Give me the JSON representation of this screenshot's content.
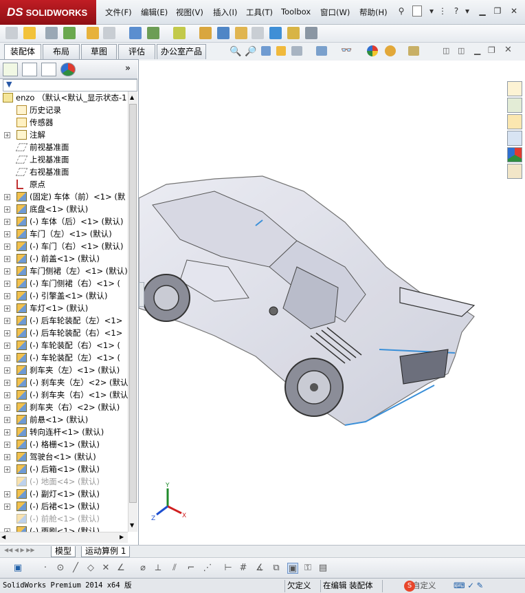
{
  "app": {
    "logo_text": "SOLIDWORKS",
    "logo_ds": "DS"
  },
  "menu": [
    "文件(F)",
    "编辑(E)",
    "视图(V)",
    "插入(I)",
    "工具(T)",
    "Toolbox",
    "窗口(W)",
    "帮助(H)"
  ],
  "command_tabs": [
    "装配体",
    "布局",
    "草图",
    "评估",
    "办公室产品"
  ],
  "tree": {
    "root": "enzo （默认<默认_显示状态-1",
    "items": [
      {
        "label": "历史记录",
        "icon": "history-icon",
        "expand": false,
        "dim": false
      },
      {
        "label": "传感器",
        "icon": "sensor-icon",
        "expand": false,
        "dim": false
      },
      {
        "label": "注解",
        "icon": "annotation-icon",
        "expand": true,
        "dim": false
      },
      {
        "label": "前视基准面",
        "icon": "plane-icon",
        "expand": false,
        "dim": false
      },
      {
        "label": "上视基准面",
        "icon": "plane-icon",
        "expand": false,
        "dim": false
      },
      {
        "label": "右视基准面",
        "icon": "plane-icon",
        "expand": false,
        "dim": false
      },
      {
        "label": "原点",
        "icon": "origin-icon",
        "expand": false,
        "dim": false
      },
      {
        "label": "(固定) 车体（前）<1> (默",
        "icon": "part-icon",
        "expand": true,
        "dim": false
      },
      {
        "label": "底盘<1> (默认)",
        "icon": "part-icon",
        "expand": true,
        "dim": false
      },
      {
        "label": "(-) 车体（后）<1> (默认)",
        "icon": "part-icon",
        "expand": true,
        "dim": false
      },
      {
        "label": "车门（左）<1> (默认)",
        "icon": "part-icon",
        "expand": true,
        "dim": false
      },
      {
        "label": "(-) 车门（右）<1> (默认)",
        "icon": "part-icon",
        "expand": true,
        "dim": false
      },
      {
        "label": "(-) 前盖<1> (默认)",
        "icon": "part-icon",
        "expand": true,
        "dim": false
      },
      {
        "label": "车门侧裙（左）<1> (默认)",
        "icon": "part-icon",
        "expand": true,
        "dim": false
      },
      {
        "label": "(-) 车门侧裙（右）<1> (",
        "icon": "part-icon",
        "expand": true,
        "dim": false
      },
      {
        "label": "(-) 引擎盖<1> (默认)",
        "icon": "part-icon",
        "expand": true,
        "dim": false
      },
      {
        "label": "车灯<1> (默认)",
        "icon": "part-icon",
        "expand": true,
        "dim": false
      },
      {
        "label": "(-) 后车轮装配（左）<1>",
        "icon": "part-icon",
        "expand": true,
        "dim": false
      },
      {
        "label": "(-) 后车轮装配（右）<1>",
        "icon": "part-icon",
        "expand": true,
        "dim": false
      },
      {
        "label": "(-) 车轮装配（右）<1> (",
        "icon": "part-icon",
        "expand": true,
        "dim": false
      },
      {
        "label": "(-) 车轮装配（左）<1> (",
        "icon": "part-icon",
        "expand": true,
        "dim": false
      },
      {
        "label": "刹车夹（左）<1> (默认)",
        "icon": "part-icon",
        "expand": true,
        "dim": false
      },
      {
        "label": "(-) 刹车夹（左）<2> (默认",
        "icon": "part-icon",
        "expand": true,
        "dim": false
      },
      {
        "label": "(-) 刹车夹（右）<1> (默认",
        "icon": "part-icon",
        "expand": true,
        "dim": false
      },
      {
        "label": "刹车夹（右）<2> (默认)",
        "icon": "part-icon",
        "expand": true,
        "dim": false
      },
      {
        "label": "前悬<1> (默认)",
        "icon": "part-icon",
        "expand": true,
        "dim": false
      },
      {
        "label": "转向连杆<1> (默认)",
        "icon": "part-icon",
        "expand": true,
        "dim": false
      },
      {
        "label": "(-) 格栅<1> (默认)",
        "icon": "part-icon",
        "expand": true,
        "dim": false
      },
      {
        "label": "驾驶台<1> (默认)",
        "icon": "part-icon",
        "expand": true,
        "dim": false
      },
      {
        "label": "(-) 后箱<1> (默认)",
        "icon": "part-icon",
        "expand": true,
        "dim": false
      },
      {
        "label": "(-) 地面<4> (默认)",
        "icon": "part-icon",
        "expand": false,
        "dim": true
      },
      {
        "label": "(-) 副灯<1> (默认)",
        "icon": "part-icon",
        "expand": true,
        "dim": false
      },
      {
        "label": "(-) 后裙<1> (默认)",
        "icon": "part-icon",
        "expand": true,
        "dim": false
      },
      {
        "label": "(-) 前舱<1> (默认)",
        "icon": "part-icon",
        "expand": false,
        "dim": true
      },
      {
        "label": "(-) 雨刷<1> (默认)",
        "icon": "part-icon",
        "expand": true,
        "dim": false
      }
    ]
  },
  "bottom_tabs": [
    "模型",
    "运动算例 1"
  ],
  "status": {
    "product": "SolidWorks Premium 2014 x64 版",
    "definition": "欠定义",
    "editing": "在编辑 装配体",
    "custom": "自定义"
  },
  "triad": {
    "x": "X",
    "y": "Y",
    "z": "Z"
  },
  "colors": {
    "brand_red": "#b0181e",
    "accent_blue": "#1f5fa8"
  }
}
